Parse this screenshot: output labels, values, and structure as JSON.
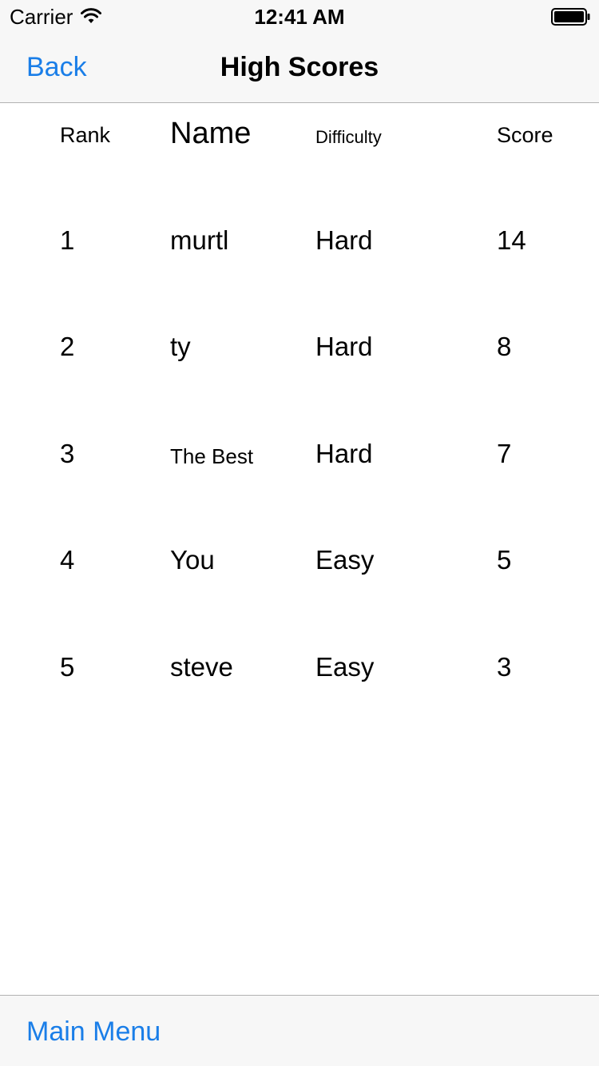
{
  "status_bar": {
    "carrier": "Carrier",
    "time": "12:41 AM",
    "wifi_icon": "wifi-icon",
    "battery_icon": "battery-icon"
  },
  "nav": {
    "back_label": "Back",
    "title": "High Scores"
  },
  "table": {
    "headers": {
      "rank": "Rank",
      "name": "Name",
      "difficulty": "Difficulty",
      "score": "Score"
    },
    "rows": [
      {
        "rank": "1",
        "name": "murtl",
        "difficulty": "Hard",
        "score": "14"
      },
      {
        "rank": "2",
        "name": "ty",
        "difficulty": "Hard",
        "score": "8"
      },
      {
        "rank": "3",
        "name": "The Best",
        "difficulty": "Hard",
        "score": "7"
      },
      {
        "rank": "4",
        "name": "You",
        "difficulty": "Easy",
        "score": "5"
      },
      {
        "rank": "5",
        "name": "steve",
        "difficulty": "Easy",
        "score": "3"
      }
    ]
  },
  "toolbar": {
    "main_menu_label": "Main Menu"
  },
  "colors": {
    "accent": "#1a7ee8",
    "bar_background": "#f7f7f7",
    "separator": "#b2b2b2"
  }
}
